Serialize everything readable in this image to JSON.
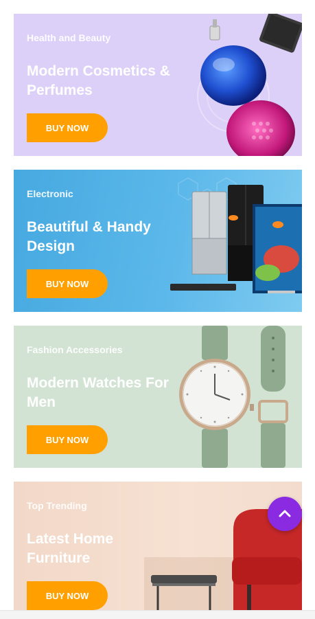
{
  "banners": [
    {
      "tag": "Health and Beauty",
      "title": "Modern Cosmetics & Perfumes",
      "button": "BUY NOW"
    },
    {
      "tag": "Electronic",
      "title": "Beautiful & Handy Design",
      "button": "BUY NOW"
    },
    {
      "tag": "Fashion Accessories",
      "title": "Modern Watches For Men",
      "button": "BUY NOW"
    },
    {
      "tag": "Top Trending",
      "title": "Latest Home Furniture",
      "button": "BUY NOW"
    }
  ],
  "colors": {
    "button": "#ffa000",
    "scroll_top": "#8a2be2"
  },
  "icons": {
    "scroll_top": "chevron-up-icon"
  }
}
